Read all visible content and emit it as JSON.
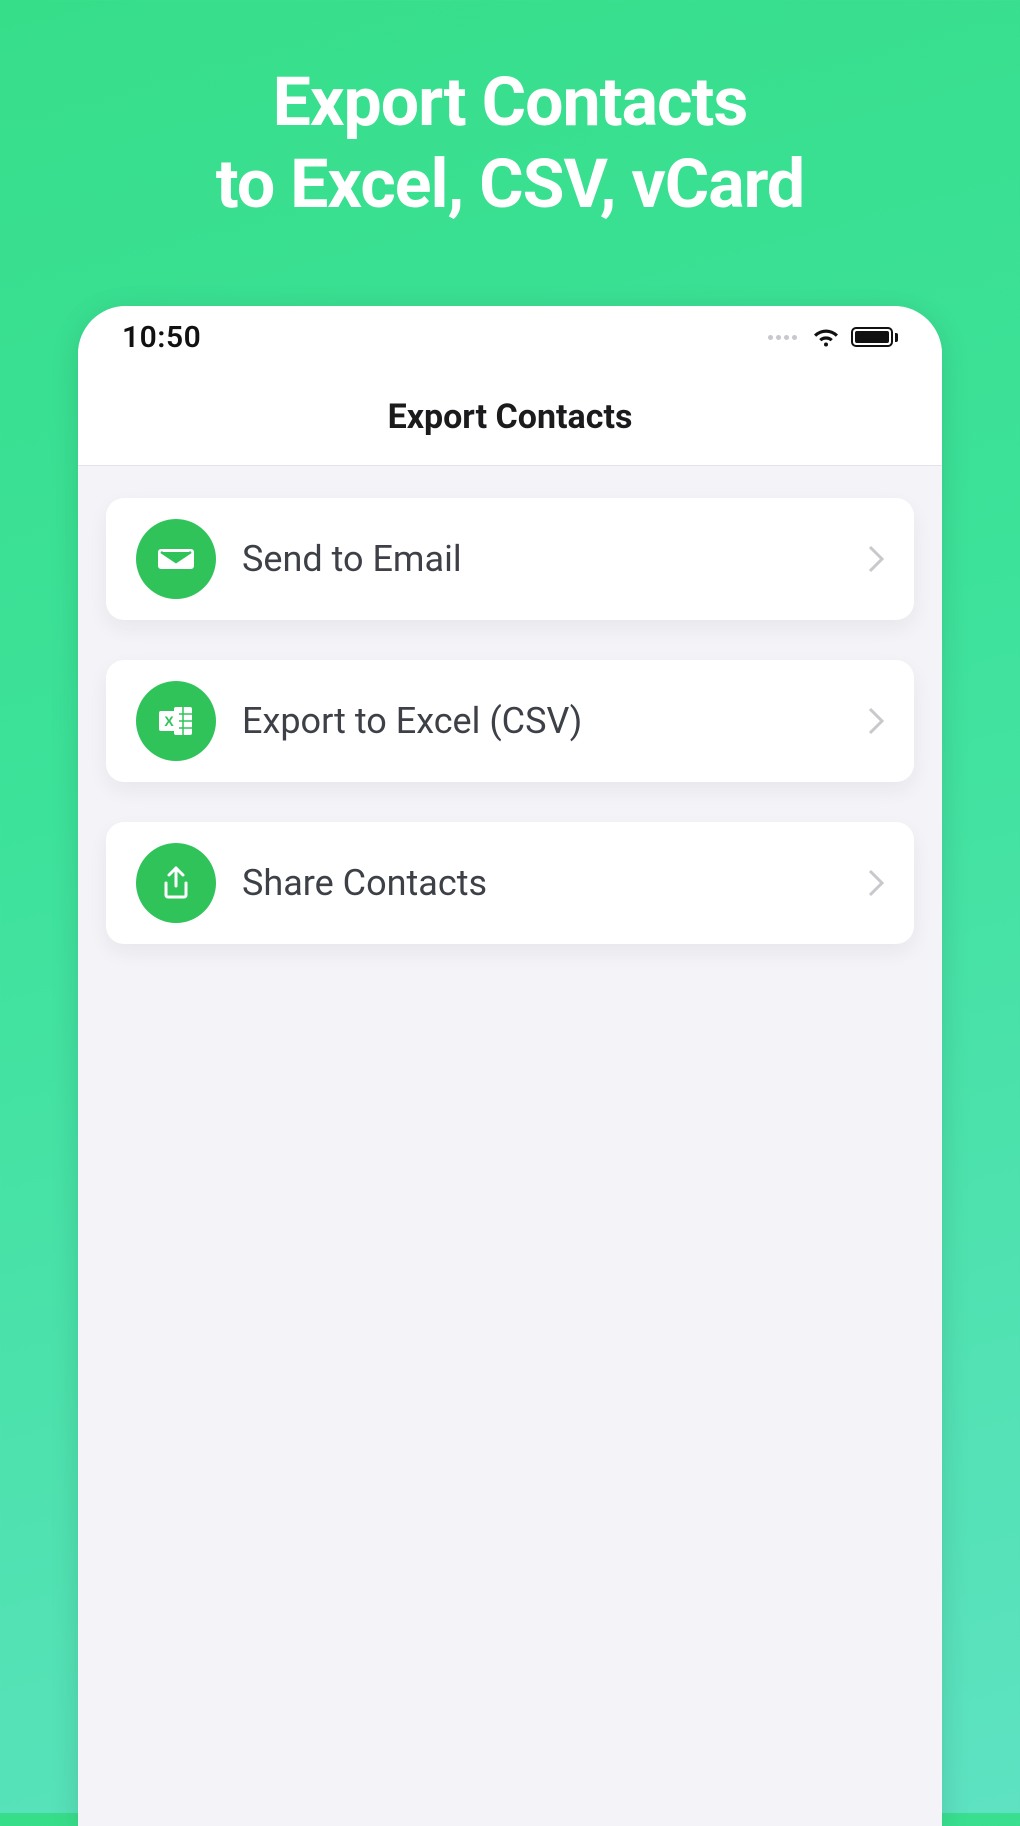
{
  "hero": {
    "line1": "Export Contacts",
    "line2": "to Excel, CSV, vCard"
  },
  "statusbar": {
    "time": "10:50"
  },
  "navbar": {
    "title": "Export Contacts"
  },
  "options": [
    {
      "icon": "mail-icon",
      "label": "Send to Email"
    },
    {
      "icon": "excel-icon",
      "label": "Export to Excel (CSV)"
    },
    {
      "icon": "share-icon",
      "label": "Share Contacts"
    }
  ],
  "colors": {
    "accent": "#2fc35a"
  }
}
